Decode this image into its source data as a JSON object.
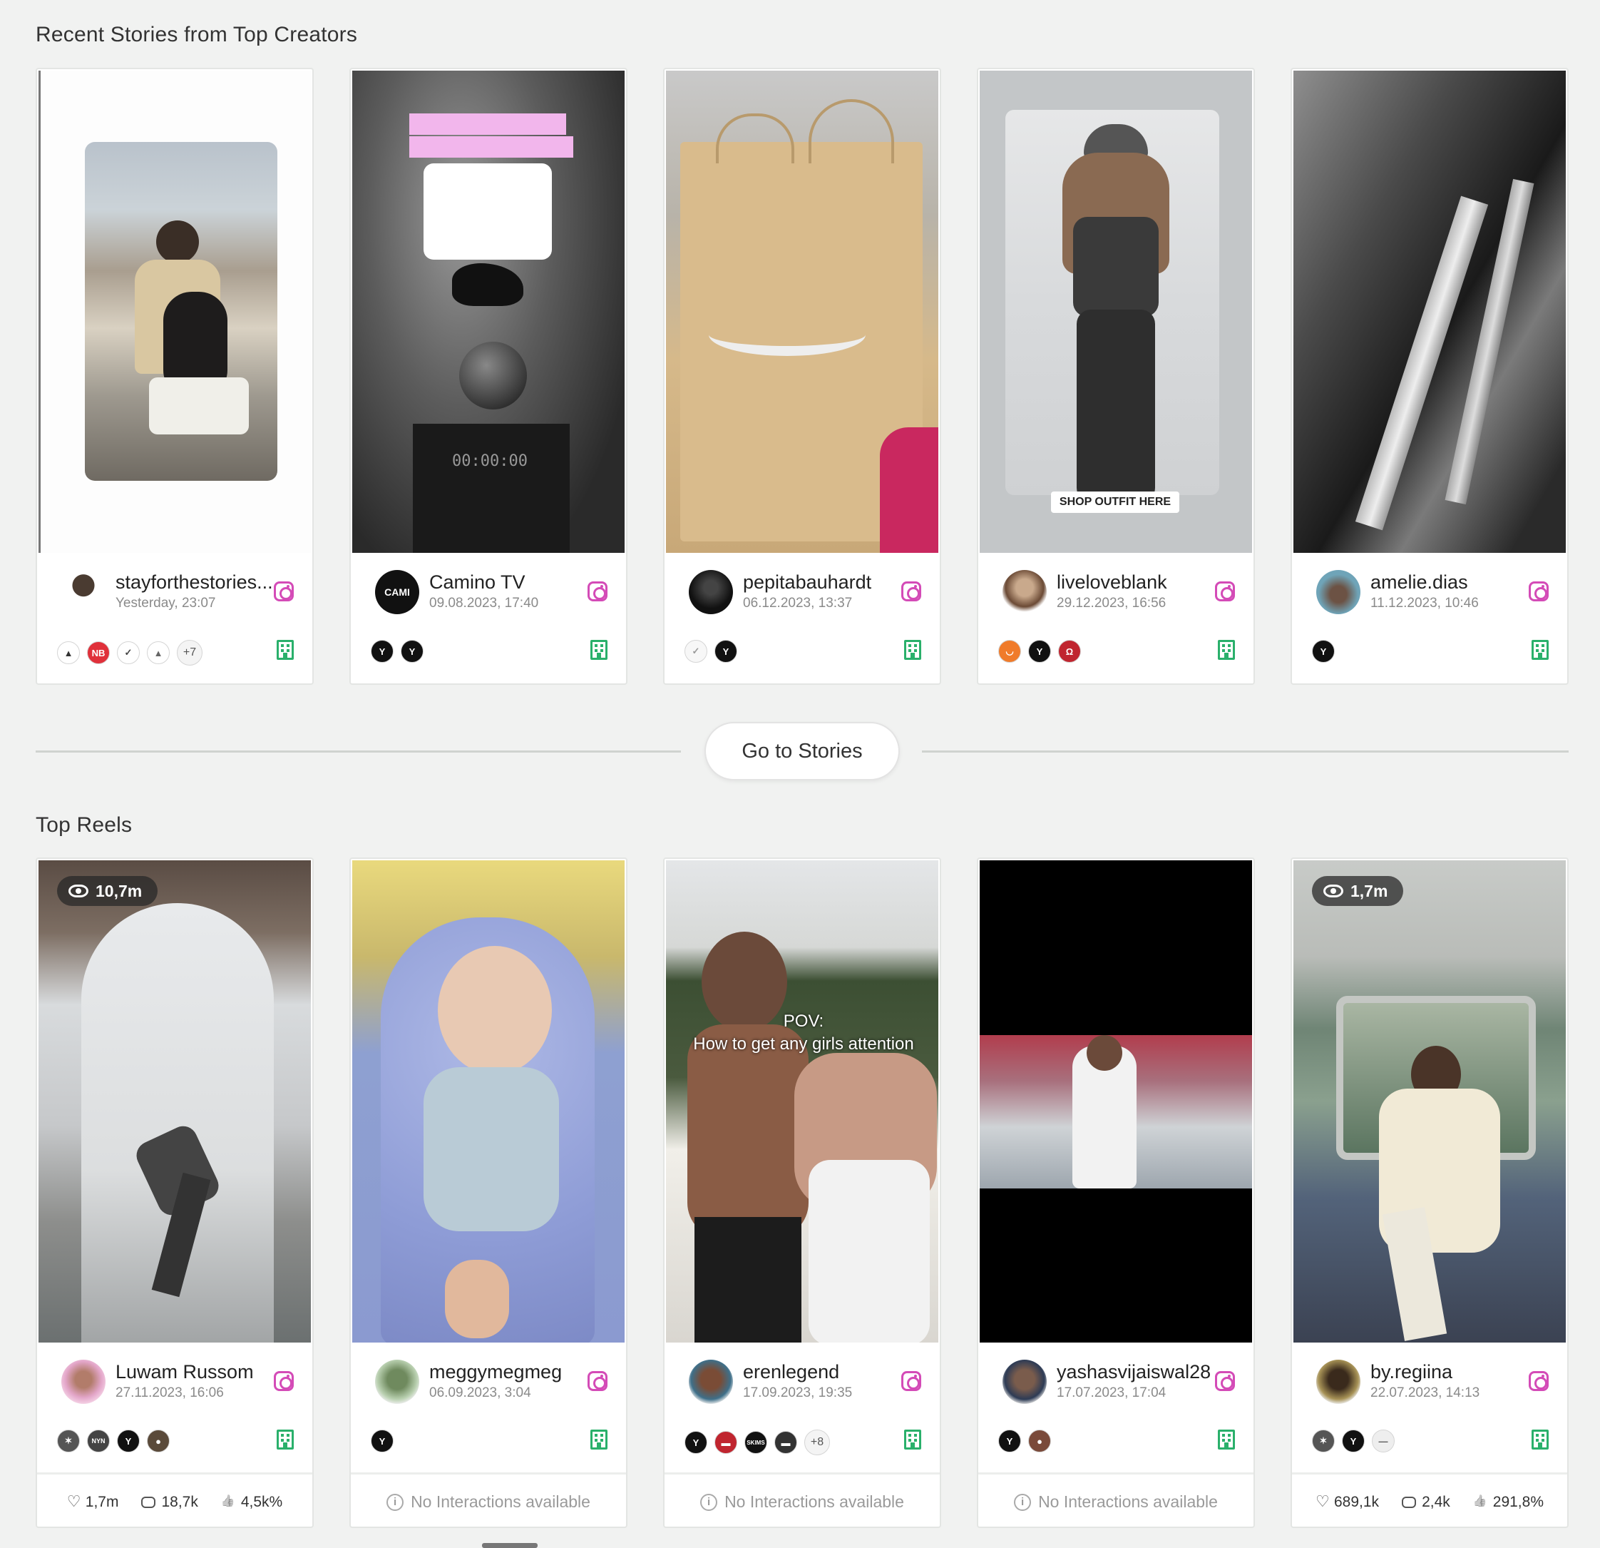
{
  "stories_section": {
    "title": "Recent Stories from Top Creators",
    "cards": [
      {
        "name": "stayforthestories...",
        "date": "Yesterday, 23:07",
        "brands": [
          "#333",
          "#e0303a",
          "#444",
          "#666"
        ],
        "more": "+7"
      },
      {
        "name": "Camino TV",
        "date": "09.08.2023, 17:40",
        "brands": [
          "#111",
          "#111"
        ],
        "more": ""
      },
      {
        "name": "pepitabauhardt",
        "date": "06.12.2023, 13:37",
        "brands": [
          "#f2f2f2",
          "#111"
        ],
        "more": ""
      },
      {
        "name": "liveloveblank",
        "date": "29.12.2023, 16:56",
        "brands": [
          "#f07b2a",
          "#111",
          "#c0252f"
        ],
        "more": ""
      },
      {
        "name": "amelie.dias",
        "date": "11.12.2023, 10:46",
        "brands": [
          "#111"
        ],
        "more": ""
      }
    ]
  },
  "go_to_stories": "Go to Stories",
  "reels_section": {
    "title": "Top Reels",
    "cards": [
      {
        "name": "Luwam Russom",
        "date": "27.11.2023, 16:06",
        "views": "10,7m",
        "brands": [
          "#555",
          "#444",
          "#111",
          "#5a4a3a"
        ],
        "more": "",
        "likes": "1,7m",
        "comments": "18,7k",
        "engagement": "4,5k%",
        "no_interactions": ""
      },
      {
        "name": "meggymegmeg",
        "date": "06.09.2023, 3:04",
        "views": "",
        "brands": [
          "#111"
        ],
        "more": "",
        "likes": "",
        "comments": "",
        "engagement": "",
        "no_interactions": "No Interactions available"
      },
      {
        "name": "erenlegend",
        "date": "17.09.2023, 19:35",
        "views": "",
        "brands": [
          "#111",
          "#c0252f",
          "#111",
          "#333"
        ],
        "more": "+8",
        "likes": "",
        "comments": "",
        "engagement": "",
        "no_interactions": "No Interactions available"
      },
      {
        "name": "yashasvijaiswal28",
        "date": "17.07.2023, 17:04",
        "views": "",
        "brands": [
          "#111",
          "#7a4a3a"
        ],
        "more": "",
        "likes": "",
        "comments": "",
        "engagement": "",
        "no_interactions": "No Interactions available"
      },
      {
        "name": "by.regiina",
        "date": "22.07.2023, 14:13",
        "views": "1,7m",
        "brands": [
          "#555",
          "#111",
          "#eee"
        ],
        "more": "",
        "likes": "689,1k",
        "comments": "2,4k",
        "engagement": "291,8%",
        "no_interactions": ""
      }
    ]
  },
  "colors": {
    "instagram": "#d44bb7",
    "building": "#2ab06b",
    "background": "#f1f2f1"
  }
}
